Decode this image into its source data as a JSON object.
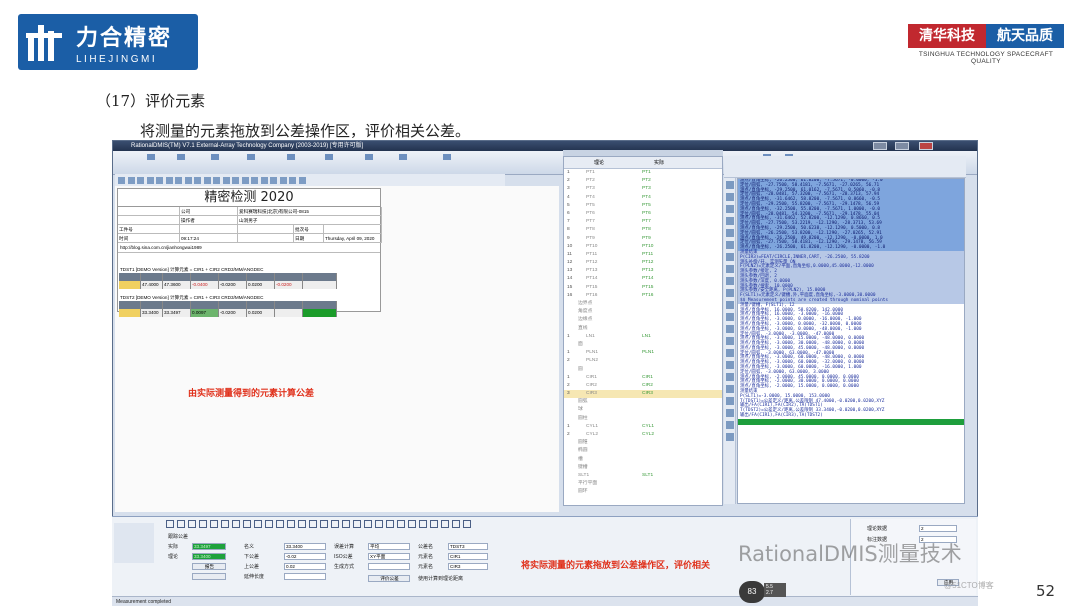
{
  "logo_left": {
    "cn": "力合精密",
    "en": "LIHEJINGMI"
  },
  "logo_right": {
    "a": "清华科技",
    "b": "航天品质",
    "sub": "TSINGHUA TECHNOLOGY SPACECRAFT QUALITY"
  },
  "heading": "（17）评价元素",
  "subtitle": "将测量的元素拖放到公差操作区，评价相关公差。",
  "app": {
    "title": "RationalDMIS(TM) V7.1   External-Array Technology Company (2003-2019) [专用许可版]",
    "report": {
      "title": "精密检测  2020",
      "rows": [
        [
          "",
          "公司",
          "爱科赛瑞科技(北京)有限公司-0815",
          "",
          ""
        ],
        [
          "",
          "操作者",
          "山洞男子",
          "",
          ""
        ],
        [
          "工件号",
          "",
          "",
          "批次号",
          ""
        ],
        [
          "时间",
          "09:17:24",
          "",
          "日期",
          "Thursday, April 09, 2020"
        ]
      ],
      "url": "http://blog.sina.com.cn/jianhongwai1989"
    },
    "tolerances": [
      {
        "header": "TDST1  [DEMO Version]  计算元素 = CIR1 + CIR2                         CRD3/MM/ANGDEC",
        "values": [
          "",
          "47.4000",
          "47.3600",
          "-0.0400",
          "-0.0200",
          "0.0200",
          "-0.0200",
          ""
        ]
      },
      {
        "header": "TDST2  [DEMO Version]  计算元素 = CIR1 + CIR3                         CRD3/MM/ANGDEC",
        "values": [
          "",
          "33.3400",
          "33.3497",
          "0.0097",
          "-0.0200",
          "0.0200",
          "",
          ""
        ]
      }
    ],
    "annotation_canvas": "由实际测量得到的元素计算公差",
    "annotation_bottom": "将实际测量的元素拖放到公差操作区，评价相关",
    "tree_header": {
      "col1": "理论",
      "col2": "实际"
    },
    "tree": [
      {
        "n": "1",
        "a": "PT1",
        "b": "PT1"
      },
      {
        "n": "2",
        "a": "PT2",
        "b": "PT2"
      },
      {
        "n": "3",
        "a": "PT3",
        "b": "PT3"
      },
      {
        "n": "4",
        "a": "PT4",
        "b": "PT4"
      },
      {
        "n": "5",
        "a": "PT5",
        "b": "PT5"
      },
      {
        "n": "6",
        "a": "PT6",
        "b": "PT6"
      },
      {
        "n": "7",
        "a": "PT7",
        "b": "PT7"
      },
      {
        "n": "8",
        "a": "PT8",
        "b": "PT8"
      },
      {
        "n": "9",
        "a": "PT9",
        "b": "PT9"
      },
      {
        "n": "10",
        "a": "PT10",
        "b": "PT10"
      },
      {
        "n": "11",
        "a": "PT11",
        "b": "PT11"
      },
      {
        "n": "12",
        "a": "PT12",
        "b": "PT12"
      },
      {
        "n": "13",
        "a": "PT13",
        "b": "PT13"
      },
      {
        "n": "14",
        "a": "PT14",
        "b": "PT14"
      },
      {
        "n": "15",
        "a": "PT15",
        "b": "PT15"
      },
      {
        "n": "16",
        "a": "PT16",
        "b": "PT16"
      },
      {
        "n": "",
        "a": "边界点",
        "b": ""
      },
      {
        "n": "",
        "a": "角度点",
        "b": ""
      },
      {
        "n": "",
        "a": "边缘点",
        "b": ""
      },
      {
        "n": "",
        "a": "直线",
        "b": ""
      },
      {
        "n": "1",
        "a": "LN1",
        "b": "LN1"
      },
      {
        "n": "",
        "a": "面",
        "b": ""
      },
      {
        "n": "1",
        "a": "PLN1",
        "b": "PLN1"
      },
      {
        "n": "2",
        "a": "PLN2",
        "b": ""
      },
      {
        "n": "",
        "a": "圆",
        "b": ""
      },
      {
        "n": "1",
        "a": "CIR1",
        "b": "CIR1"
      },
      {
        "n": "2",
        "a": "CIR2",
        "b": "CIR2"
      },
      {
        "n": "3",
        "a": "CIR3",
        "b": "CIR3"
      },
      {
        "n": "",
        "a": "圆弧",
        "b": ""
      },
      {
        "n": "",
        "a": "球",
        "b": ""
      },
      {
        "n": "",
        "a": "圆柱",
        "b": ""
      },
      {
        "n": "1",
        "a": "CYL1",
        "b": "CYL1"
      },
      {
        "n": "2",
        "a": "CYL2",
        "b": "CYL2"
      },
      {
        "n": "",
        "a": "圆锥",
        "b": ""
      },
      {
        "n": "",
        "a": "椭圆",
        "b": ""
      },
      {
        "n": "",
        "a": "槽",
        "b": ""
      },
      {
        "n": "",
        "a": "键槽",
        "b": ""
      },
      {
        "n": "",
        "a": "SLT1",
        "b": "SLT1"
      },
      {
        "n": "",
        "a": "平行平面",
        "b": ""
      },
      {
        "n": "",
        "a": "圆环",
        "b": ""
      }
    ],
    "code_lines": [
      "测点/直角坐标, -26.2500, 61.8200, -7.5671, -0.0000, -1.0",
      "  定位/圆弧, -27.7500, 58.4181, -7.5671, -27.0265, 56.71",
      "测点/直角坐标, -29.2500, 61.0162, -7.5671, 0.5060, -0.8",
      "  定位/圆弧, -28.0481, 57.3200, -7.5671, -28.3713, 57.94",
      "测点/直角坐标, -31.6462, 58.8200, -7.5671, 0.8660, -0.5",
      "  定位/圆弧, -29.2500, 55.8200, -7.5671, -29.1478, 56.59",
      "测点/直角坐标, -32.2500, 55.8200, -7.5671, 1.0000, -0.0",
      "  定位/圆弧, -28.0481, 54.3200, -7.5671, -29.1478, 55.04",
      "测点/直角坐标, -31.6462, 52.8200, -12.1290, 0.8660, 0.5",
      "  定位/圆弧, -27.7500, 53.2219, -12.1290, -28.3713, 53.69",
      "测点/直角坐标, -29.2500, 50.6238, -12.1290, 0.5000, 0.8",
      "  定位/圆弧, -26.2500, 53.8200, -12.1290, -27.0265, 52.91",
      "测点/直角坐标, -26.2500, 49.8200, -12.1290, -0.0000, 1.0",
      "  定位/圆弧, -27.7500, 58.4181, -12.1290, -29.1478, 56.59",
      "测点/直角坐标, -26.2500, 61.8200, -12.1290, -0.0000, -1.0",
      "测量结束",
      "P(CIR3)=FEAT/CIRCLE,INNER,CART, -26.2500, 55.8200",
      "测头补偿/开, 实测矢量 ON",
      "F(PLN2)=元素定义/平面,直角坐标,0.0000,45.0000,-12.0000",
      "测头参数/接近, 2",
      "测头参数/回退, 2",
      "测头参数/深度, 0.0000",
      "测头参数/搜索, 10.0000",
      "测头参数/安全距离, P(PLN2), 15.0000",
      "F(SLT1)=元素定义/键槽,外,平面度,直角坐标,-3.0000,30.0000",
      "$$ Measurement points are created through nominal points",
      "测量/键槽, F(SLT1), 12",
      "  测点/直角坐标, 16.0000, 58.8200, 142.0000",
      "  测点/直角坐标, 16.0000, -3.0000, -16.0000",
      "  测点/直角坐标, -3.0000, 0.0000, -16.0000, -1.000",
      "  测点/直角坐标, -3.0000, 0.0000, -32.0000, 0.0000",
      "  测点/直角坐标, -3.0000, 0.0000, -48.0000, -1.000",
      "  定位/圆弧, -3.0000, -3.0000, -47.0000",
      "  测点/直角坐标, -3.0000, 15.0000, -48.0000, 0.0000",
      "  测点/直角坐标, -3.0000, 30.0000, -48.0000, 0.0000",
      "  测点/直角坐标, -3.0000, 45.0000, -48.0000, 0.0000",
      "  定位/圆弧, -3.0000, 63.0000, -47.0000",
      "  测点/直角坐标, -3.0000, 60.0000, -48.0000, 0.0000",
      "  测点/直角坐标, -3.0000, 60.0000, -32.0000, 0.0000",
      "  测点/直角坐标, -3.0000, 60.0000, -16.0000, 1.000",
      "  定位/圆弧, -3.0000, 63.0000, 3.0000",
      "  测点/直角坐标, -2.0000, 45.0000, 0.0000, 0.0000",
      "  测点/直角坐标, -2.0000, 30.0000, 0.0000, 0.0000",
      "  测点/直角坐标, -2.0000, 15.0000, 0.0000, 0.0000",
      "测量结束",
      "P(SLT1)=-3.0000, 15.0000, 153.0000",
      "T(TDST1)=公差定义/距离,公差限制 47.4000,-0.0200,0.0200,XYZ",
      "输出/FA(CIR1),FA(CIR2),TA(TDST1)",
      "T(TDST2)=公差定义/距离,公差限制 33.3400,-0.0200,0.0200,XYZ",
      "输出/FA(CIR1),FA(CIR3),TA(TDST2)"
    ],
    "bottom": {
      "section": "跟踪公差",
      "labels": [
        "实际",
        "理论",
        "名义",
        "下公差",
        "上公差",
        "延伸长度",
        "误差计算",
        "ISO公差",
        "生成方式",
        "名义类型",
        "公差名",
        "元素名",
        "元素名",
        "计算方式",
        "使用计算到理论距离"
      ],
      "values": {
        "actual": "33.3497",
        "nominal": "33.3400",
        "lower": "-0.02",
        "upper": "0.02",
        "tolname": "TDST3",
        "elem1": "CIR1",
        "elem2": "CIR3",
        "calc1": "平均",
        "calc2": "XY平面"
      },
      "btns": [
        "报告",
        "评价公差"
      ],
      "right": {
        "labels": [
          "理论数据",
          "标注数据"
        ],
        "vals": [
          "2",
          "2"
        ],
        "btn": "应用"
      }
    },
    "status": "Measurement completed"
  },
  "watermark": "RationalDMIS测量技术",
  "wm_small": "@51CTO博客",
  "gauge": {
    "val": "83",
    "sub1": "5.5",
    "sub2": "2.7"
  },
  "page_no": "52"
}
